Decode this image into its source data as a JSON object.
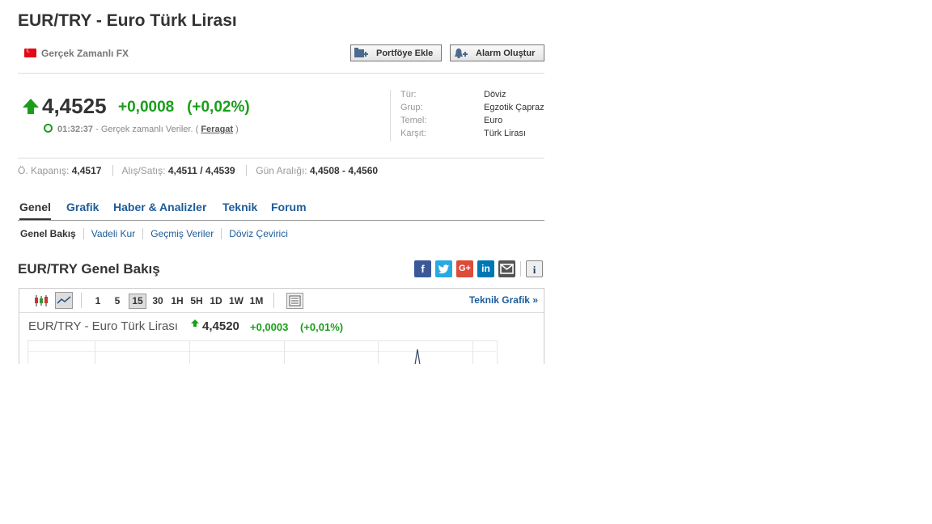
{
  "title": "EUR/TRY - Euro Türk Lirası",
  "source": {
    "label": "Gerçek Zamanlı FX",
    "flag": "turkey-flag-icon"
  },
  "buttons": {
    "portfolio": "Portföye Ekle",
    "alarm": "Alarm Oluştur"
  },
  "quote": {
    "price": "4,4525",
    "change": "+0,0008",
    "change_pct": "(+0,02%)",
    "time": "01:32:37",
    "time_note": "- Gerçek zamanlı Veriler. (",
    "disclaimer": "Feragat",
    "close_paren": ")"
  },
  "info": [
    {
      "key": "Tür:",
      "value": "Döviz"
    },
    {
      "key": "Grup:",
      "value": "Egzotik Çapraz"
    },
    {
      "key": "Temel:",
      "value": "Euro"
    },
    {
      "key": "Karşıt:",
      "value": "Türk Lirası"
    }
  ],
  "stats": {
    "prev_close_label": "Ö. Kapanış:",
    "prev_close": "4,4517",
    "bid_ask_label": "Alış/Satış:",
    "bid_ask": "4,4511 / 4,4539",
    "day_range_label": "Gün Aralığı:",
    "day_range": "4,4508 - 4,4560"
  },
  "tabs": [
    "Genel",
    "Grafik",
    "Haber & Analizler",
    "Teknik",
    "Forum"
  ],
  "subtabs": [
    "Genel Bakış",
    "Vadeli Kur",
    "Geçmiş Veriler",
    "Döviz Çevirici"
  ],
  "section_title": "EUR/TRY Genel Bakış",
  "chart": {
    "intervals": [
      "1",
      "5",
      "15",
      "30",
      "1H",
      "5H",
      "1D",
      "1W",
      "1M"
    ],
    "selected_interval": "15",
    "tech_link": "Teknik Grafik »",
    "title": "EUR/TRY - Euro Türk Lirası",
    "price": "4,4520",
    "change": "+0,0003",
    "change_pct": "(+0,01%)"
  },
  "colors": {
    "up": "#1a9e1a",
    "link": "#1e5b99"
  }
}
